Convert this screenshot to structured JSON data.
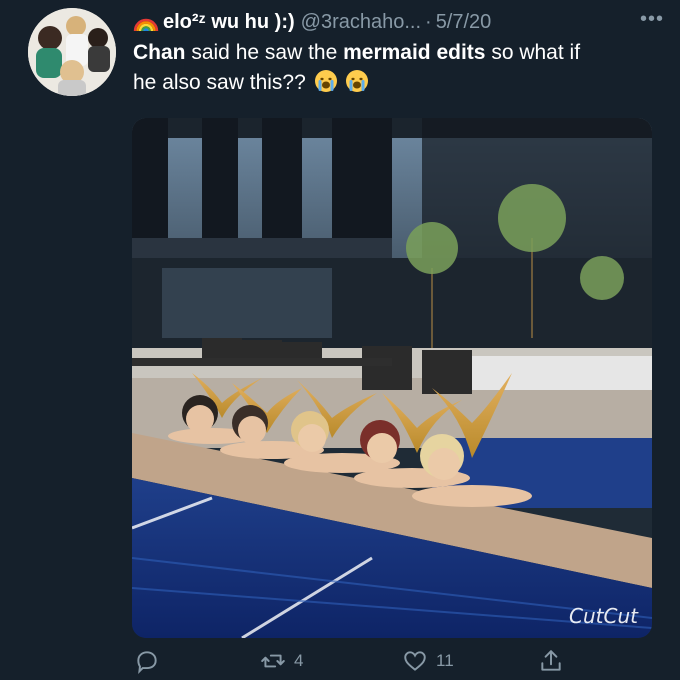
{
  "tweet": {
    "display_name": "elo²ᶻ wu hu ):)",
    "handle": "@3rachaho...",
    "separator": "·",
    "date": "5/7/20",
    "more_label": "•••",
    "text_parts": [
      "Chan",
      " said he saw the ",
      "mermaid edits",
      " so what if he also saw this??"
    ],
    "emojis": [
      "crying-face-emoji",
      "crying-face-emoji"
    ]
  },
  "media": {
    "watermark": "CutCut"
  },
  "actions": {
    "reply_count": "",
    "retweet_count": "4",
    "like_count": "11"
  },
  "colors": {
    "background": "#15202b",
    "secondary_text": "#8899a6",
    "primary_text": "#ffffff"
  },
  "icons": [
    "rainbow-icon",
    "more-icon",
    "reply-icon",
    "retweet-icon",
    "like-icon",
    "share-icon"
  ]
}
